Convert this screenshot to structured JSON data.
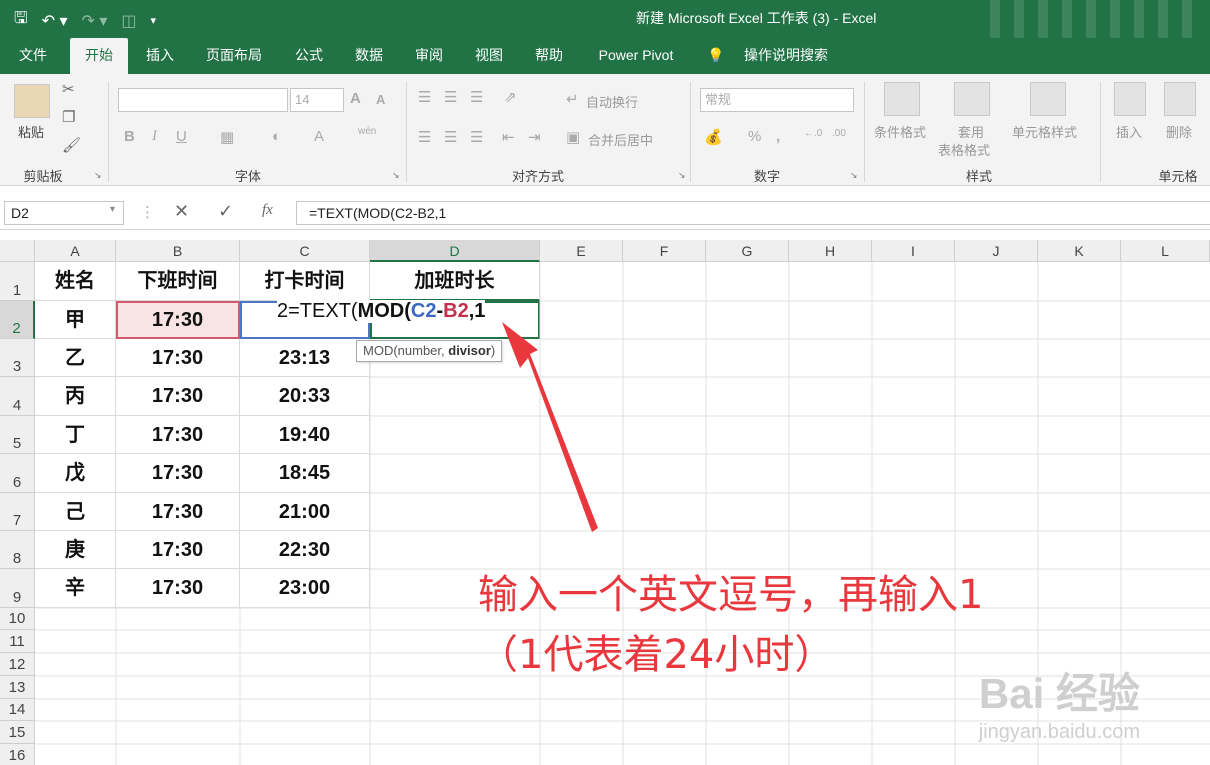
{
  "window": {
    "title": "新建 Microsoft Excel 工作表 (3)  -  Excel"
  },
  "qat": {
    "save_icon": "save-icon",
    "undo_icon": "undo-icon",
    "redo_icon": "redo-icon"
  },
  "tabs": [
    "文件",
    "开始",
    "插入",
    "页面布局",
    "公式",
    "数据",
    "审阅",
    "视图",
    "帮助",
    "Power Pivot"
  ],
  "search_label": "操作说明搜索",
  "ribbon": {
    "clipboard": {
      "paste": "粘贴",
      "label": "剪贴板"
    },
    "font": {
      "size": "14",
      "grow": "A",
      "shrink": "A",
      "bold": "B",
      "italic": "I",
      "underline": "U",
      "font_color": "A",
      "phonetic": "wén",
      "label": "字体"
    },
    "align": {
      "wrap": "自动换行",
      "merge": "合并后居中",
      "label": "对齐方式"
    },
    "number": {
      "format": "常规",
      "percent": "%",
      "comma": ",",
      "label": "数字"
    },
    "styles": {
      "conditional": "条件格式",
      "table": "套用",
      "table2": "表格格式",
      "cell": "单元格样式",
      "label": "样式"
    },
    "cells": {
      "insert": "插入",
      "delete": "删除",
      "label": "单元格"
    }
  },
  "formula_bar": {
    "name_box": "D2",
    "formula": "=TEXT(MOD(C2-B2,1"
  },
  "columns": [
    "A",
    "B",
    "C",
    "D",
    "E",
    "F",
    "G",
    "H",
    "I",
    "J",
    "K",
    "L"
  ],
  "rows": [
    "1",
    "2",
    "3",
    "4",
    "5",
    "6",
    "7",
    "8",
    "9",
    "10",
    "11",
    "12",
    "13",
    "14",
    "15",
    "16"
  ],
  "table": {
    "headers": [
      "姓名",
      "下班时间",
      "打卡时间",
      "加班时长"
    ],
    "rows": [
      [
        "甲",
        "17:30",
        "2"
      ],
      [
        "乙",
        "17:30",
        "23:13"
      ],
      [
        "丙",
        "17:30",
        "20:33"
      ],
      [
        "丁",
        "17:30",
        "19:40"
      ],
      [
        "戊",
        "17:30",
        "18:45"
      ],
      [
        "己",
        "17:30",
        "21:00"
      ],
      [
        "庚",
        "17:30",
        "22:30"
      ],
      [
        "辛",
        "17:30",
        "23:00"
      ]
    ]
  },
  "editing": {
    "p1": "=TEXT(",
    "p2": "MOD(",
    "p3": "C2",
    "p4": "-",
    "p5": "B2",
    "p6": ",1"
  },
  "tooltip": {
    "a": "MOD(number, ",
    "b": "divisor",
    "c": ")"
  },
  "annotation": {
    "line1": "输入一个英文逗号，再输入1",
    "line2": "（1代表着24小时）"
  },
  "watermark": {
    "line1": "Bai 经验",
    "line2": "jingyan.baidu.com"
  },
  "colors": {
    "excel_green": "#217346",
    "annotation_red": "#e8373d",
    "ref_blue": "#3a67c4",
    "ref_red": "#c2304a"
  }
}
